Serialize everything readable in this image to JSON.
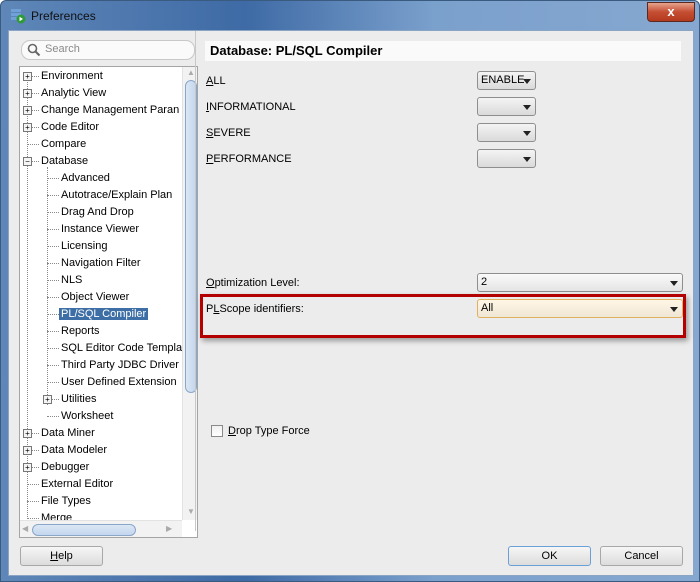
{
  "window": {
    "title": "Preferences",
    "close_label": "x"
  },
  "search": {
    "placeholder": "Search"
  },
  "tree": {
    "items": [
      {
        "label": "Environment",
        "expander": "+"
      },
      {
        "label": "Analytic View",
        "expander": "+"
      },
      {
        "label": "Change Management Paran",
        "expander": "+"
      },
      {
        "label": "Code Editor",
        "expander": "+"
      },
      {
        "label": "Compare"
      },
      {
        "label": "Database",
        "expander": "−"
      },
      {
        "label": "Advanced"
      },
      {
        "label": "Autotrace/Explain Plan"
      },
      {
        "label": "Drag And Drop"
      },
      {
        "label": "Instance Viewer"
      },
      {
        "label": "Licensing"
      },
      {
        "label": "Navigation Filter"
      },
      {
        "label": "NLS"
      },
      {
        "label": "Object Viewer"
      },
      {
        "label": "PL/SQL Compiler",
        "selected": true
      },
      {
        "label": "Reports"
      },
      {
        "label": "SQL Editor Code Templa"
      },
      {
        "label": "Third Party JDBC Driver"
      },
      {
        "label": "User Defined Extension"
      },
      {
        "label": "Utilities",
        "expander": "+"
      },
      {
        "label": "Worksheet"
      },
      {
        "label": "Data Miner",
        "expander": "+"
      },
      {
        "label": "Data Modeler",
        "expander": "+"
      },
      {
        "label": "Debugger",
        "expander": "+"
      },
      {
        "label": "External Editor"
      },
      {
        "label": "File Types"
      },
      {
        "label": "Merge"
      }
    ]
  },
  "main": {
    "title": "Database: PL/SQL Compiler",
    "warnings": [
      {
        "label_mnemonic": "A",
        "label_rest": "LL",
        "value": "ENABLE"
      },
      {
        "label_mnemonic": "I",
        "label_rest": "NFORMATIONAL",
        "value": ""
      },
      {
        "label_mnemonic": "S",
        "label_rest": "EVERE",
        "value": ""
      },
      {
        "label_mnemonic": "P",
        "label_rest": "ERFORMANCE",
        "value": ""
      }
    ],
    "optimization": {
      "label_mnemonic": "O",
      "label_rest": "ptimization Level:",
      "value": "2"
    },
    "plscope": {
      "label_pre": "P",
      "label_mnemonic": "L",
      "label_rest": "Scope identifiers:",
      "value": "All"
    },
    "drop_type_force": {
      "label_mnemonic": "D",
      "label_rest": "rop Type Force",
      "checked": false
    }
  },
  "footer": {
    "help_mnemonic": "H",
    "help_rest": "elp",
    "ok_label": "OK",
    "cancel_label": "Cancel"
  },
  "colors": {
    "highlight_border": "#b30000",
    "selection": "#3d6fa6"
  }
}
